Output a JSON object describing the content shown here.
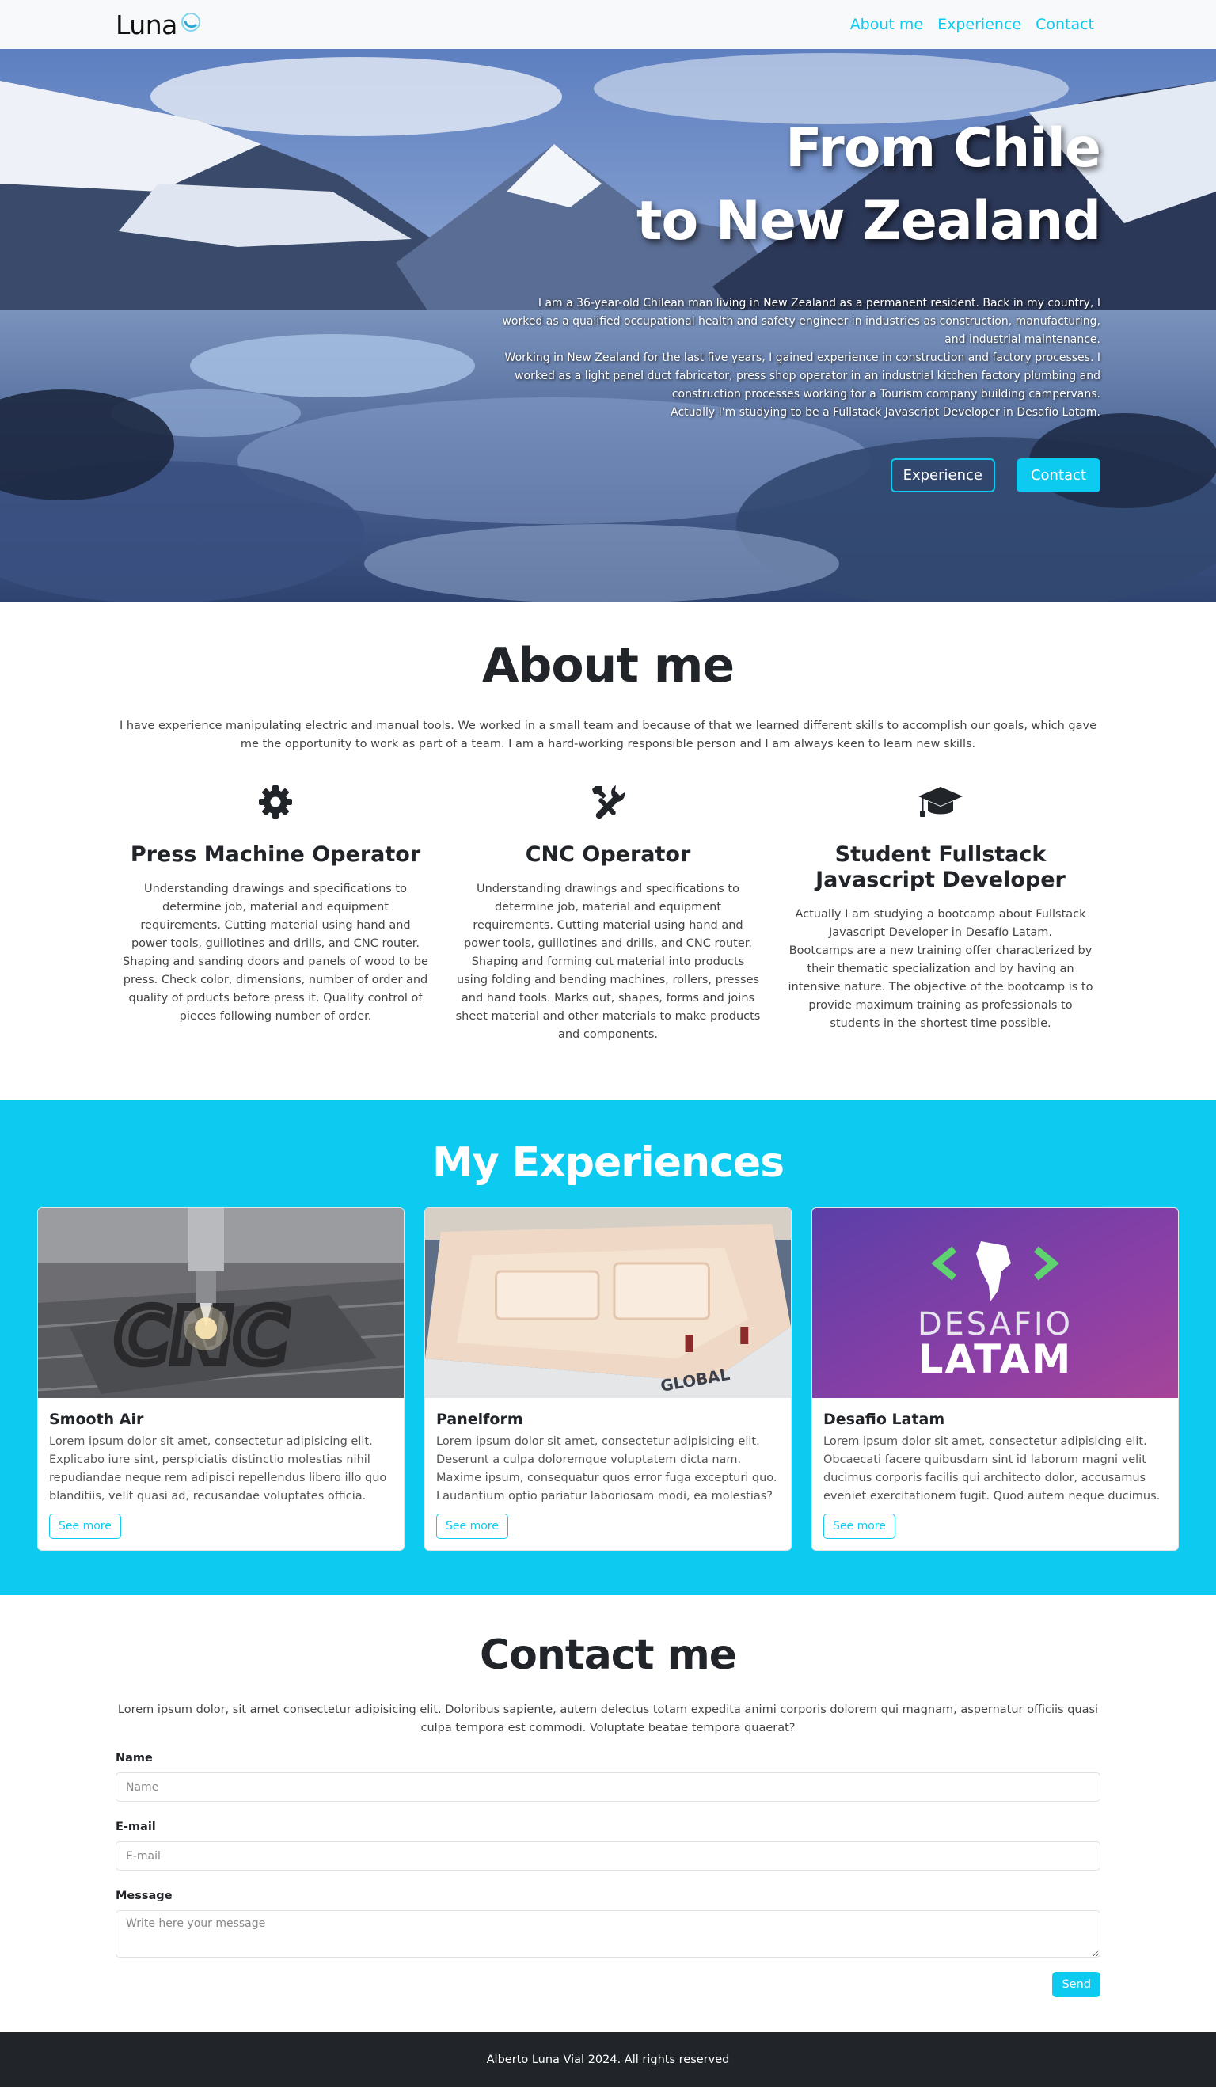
{
  "nav": {
    "brand": "Luna",
    "links": [
      "About me",
      "Experience",
      "Contact"
    ]
  },
  "hero": {
    "title_line1": "From Chile",
    "title_line2": "to New Zealand",
    "paragraphs": [
      "I am a 36-year-old Chilean man living in New Zealand as a permanent resident. Back in my country, I worked as a qualified occupational health and safety engineer in industries as construction, manufacturing, and industrial maintenance.",
      "Working in New Zealand for the last five years, I gained experience in construction and factory processes. I worked as a light panel duct fabricator, press shop operator in an industrial kitchen factory plumbing and construction processes working for a Tourism company building campervans.",
      "Actually I'm studying to be a Fullstack Javascript Developer in Desafío Latam."
    ],
    "btn_experience": "Experience",
    "btn_contact": "Contact"
  },
  "about": {
    "title": "About me",
    "intro": "I have experience manipulating electric and manual tools. We worked in a small team and because of that we learned different skills to accomplish our goals, which gave me the opportunity to work as part of a team. I am a hard-working responsible person and I am always keen to learn new skills.",
    "skills": [
      {
        "icon": "gear-icon",
        "title": "Press Machine Operator",
        "text": [
          "Understanding drawings and specifications to determine job, material and equipment requirements. Cutting material using hand and power tools, guillotines and drills, and CNC router. Shaping and sanding doors and panels of wood to be press. Check color, dimensions, number of order and quality of prducts before press it. Quality control of pieces following number of order."
        ]
      },
      {
        "icon": "tools-icon",
        "title": "CNC Operator",
        "text": [
          "Understanding drawings and specifications to determine job, material and equipment requirements. Cutting material using hand and power tools, guillotines and drills, and CNC router. Shaping and forming cut material into products using folding and bending machines, rollers, presses and hand tools. Marks out, shapes, forms and joins sheet material and other materials to make products and components."
        ]
      },
      {
        "icon": "graduation-cap-icon",
        "title": "Student Fullstack Javascript Developer",
        "text": [
          "Actually I am studying a bootcamp about Fullstack Javascript Developer in Desafío Latam.",
          "Bootcamps are a new training offer characterized by their thematic specialization and by having an intensive nature. The objective of the bootcamp is to provide maximum training as professionals to students in the shortest time possible."
        ]
      }
    ]
  },
  "experiences": {
    "title": "My Experiences",
    "cards": [
      {
        "title": "Smooth Air",
        "text": "Lorem ipsum dolor sit amet, consectetur adipisicing elit. Explicabo iure sint, perspiciatis distinctio molestias nihil repudiandae neque rem adipisci repellendus libero illo quo blanditiis, velit quasi ad, recusandae voluptates officia.",
        "button": "See more"
      },
      {
        "title": "Panelform",
        "text": "Lorem ipsum dolor sit amet, consectetur adipisicing elit. Deserunt a culpa doloremque voluptatem dicta nam. Maxime ipsum, consequatur quos error fuga excepturi quo. Laudantium optio pariatur laboriosam modi, ea molestias?",
        "button": "See more",
        "image_text": "GLOBAL"
      },
      {
        "title": "Desafio Latam",
        "text": "Lorem ipsum dolor sit amet, consectetur adipisicing elit. Obcaecati facere quibusdam sint id laborum magni velit ducimus corporis facilis qui architecto dolor, accusamus eveniet exercitationem fugit. Quod autem neque ducimus.",
        "button": "See more",
        "logo_line1": "DESAFIO",
        "logo_line2": "LATAM"
      }
    ]
  },
  "contact": {
    "title": "Contact me",
    "intro": "Lorem ipsum dolor, sit amet consectetur adipisicing elit. Doloribus sapiente, autem delectus totam expedita animi corporis dolorem qui magnam, aspernatur officiis quasi culpa tempora est commodi. Voluptate beatae tempora quaerat?",
    "name_label": "Name",
    "name_placeholder": "Name",
    "email_label": "E-mail",
    "email_placeholder": "E-mail",
    "message_label": "Message",
    "message_placeholder": "Write here your message",
    "send": "Send"
  },
  "footer": {
    "text": "Alberto Luna Vial 2024. All rights reserved"
  },
  "colors": {
    "accent": "#0dcaf0",
    "dark": "#212529",
    "navbar_bg": "#f8f9fa"
  }
}
